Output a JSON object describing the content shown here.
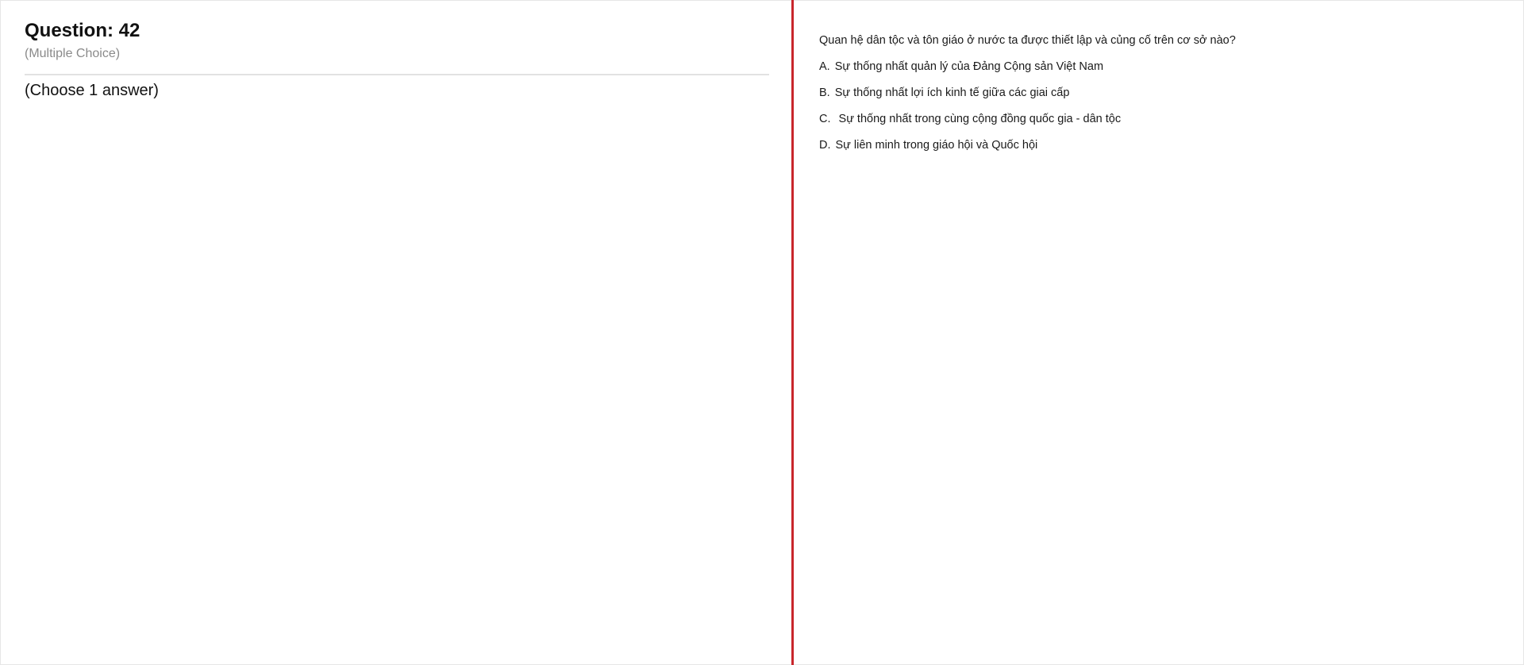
{
  "question": {
    "title": "Question: 42",
    "type": "(Multiple Choice)",
    "instruction": "(Choose 1 answer)"
  },
  "content": {
    "prompt": "Quan hệ dân tộc và tôn giáo ở nước ta được thiết lập và củng cố trên cơ sở nào?",
    "options": [
      {
        "letter": "A.",
        "text": "Sự thống nhất quản lý của Đảng Cộng sản Việt Nam"
      },
      {
        "letter": "B.",
        "text": "Sự thống nhất lợi ích kinh tế giữa các giai cấp"
      },
      {
        "letter": "C.",
        "text": " Sự thống nhất trong cùng cộng đồng quốc gia - dân tộc"
      },
      {
        "letter": "D.",
        "text": "Sự liên minh trong giáo hội và Quốc hội"
      }
    ]
  },
  "colors": {
    "divider": "#c8262c",
    "subtitle": "#8a8a8a",
    "rule": "#e2e2e2"
  }
}
